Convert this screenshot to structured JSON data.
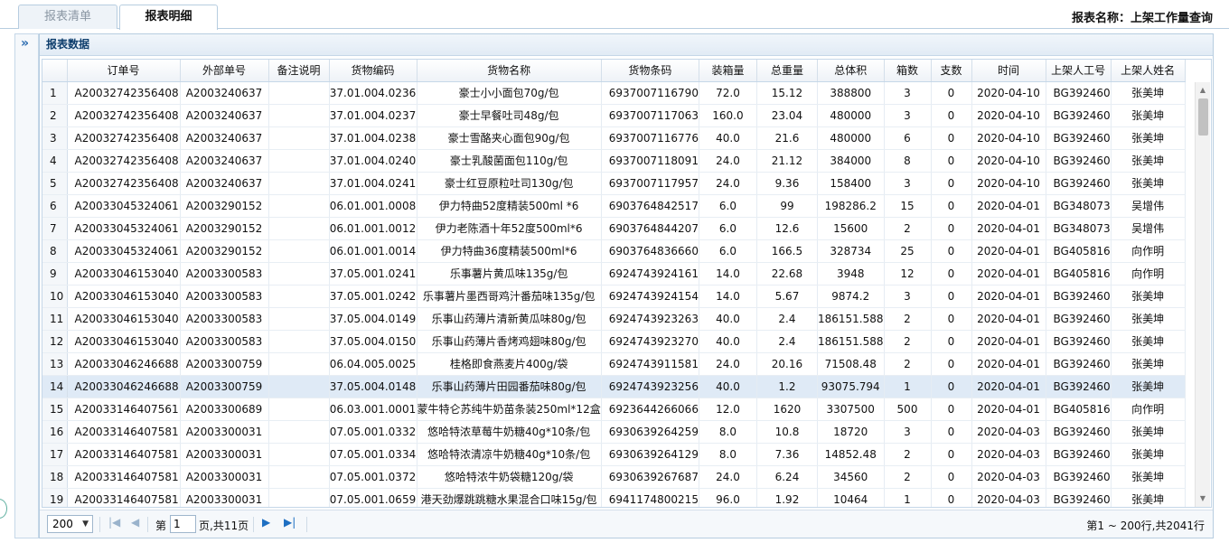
{
  "tabs": [
    {
      "label": "报表清单",
      "active": false
    },
    {
      "label": "报表明细",
      "active": true
    }
  ],
  "report_name": "报表名称：上架工作量查询",
  "panel": {
    "title": "报表数据",
    "collapse_icon": "double-chevron-right-icon"
  },
  "table": {
    "columns": [
      "",
      "订单号",
      "外部单号",
      "备注说明",
      "货物编码",
      "货物名称",
      "货物条码",
      "装箱量",
      "总重量",
      "总体积",
      "箱数",
      "支数",
      "时间",
      "上架人工号",
      "上架人姓名"
    ],
    "selected_row": 14,
    "rows": [
      [
        "1",
        "A20032742356408",
        "A2003240637",
        "",
        "37.01.004.0236",
        "豪士小小面包70g/包",
        "6937007116790",
        "72.0",
        "15.12",
        "388800",
        "3",
        "0",
        "2020-04-10",
        "BG392460",
        "张美坤"
      ],
      [
        "2",
        "A20032742356408",
        "A2003240637",
        "",
        "37.01.004.0237",
        "豪士早餐吐司48g/包",
        "6937007117063",
        "160.0",
        "23.04",
        "480000",
        "3",
        "0",
        "2020-04-10",
        "BG392460",
        "张美坤"
      ],
      [
        "3",
        "A20032742356408",
        "A2003240637",
        "",
        "37.01.004.0238",
        "豪士雪酪夹心面包90g/包",
        "6937007116776",
        "40.0",
        "21.6",
        "480000",
        "6",
        "0",
        "2020-04-10",
        "BG392460",
        "张美坤"
      ],
      [
        "4",
        "A20032742356408",
        "A2003240637",
        "",
        "37.01.004.0240",
        "豪士乳酸菌面包110g/包",
        "6937007118091",
        "24.0",
        "21.12",
        "384000",
        "8",
        "0",
        "2020-04-10",
        "BG392460",
        "张美坤"
      ],
      [
        "5",
        "A20032742356408",
        "A2003240637",
        "",
        "37.01.004.0241",
        "豪士红豆原粒吐司130g/包",
        "6937007117957",
        "24.0",
        "9.36",
        "158400",
        "3",
        "0",
        "2020-04-10",
        "BG392460",
        "张美坤"
      ],
      [
        "6",
        "A20033045324061",
        "A2003290152",
        "",
        "06.01.001.0008",
        "伊力特曲52度精装500ml *6",
        "6903764842517",
        "6.0",
        "99",
        "198286.2",
        "15",
        "0",
        "2020-04-01",
        "BG348073",
        "吴增伟"
      ],
      [
        "7",
        "A20033045324061",
        "A2003290152",
        "",
        "06.01.001.0012",
        "伊力老陈酒十年52度500ml*6",
        "6903764844207",
        "6.0",
        "12.6",
        "15600",
        "2",
        "0",
        "2020-04-01",
        "BG348073",
        "吴增伟"
      ],
      [
        "8",
        "A20033045324061",
        "A2003290152",
        "",
        "06.01.001.0014",
        "伊力特曲36度精装500ml*6",
        "6903764836660",
        "6.0",
        "166.5",
        "328734",
        "25",
        "0",
        "2020-04-01",
        "BG405816",
        "向作明"
      ],
      [
        "9",
        "A20033046153040",
        "A2003300583",
        "",
        "37.05.001.0241",
        "乐事薯片黄瓜味135g/包",
        "6924743924161",
        "14.0",
        "22.68",
        "3948",
        "12",
        "0",
        "2020-04-01",
        "BG405816",
        "向作明"
      ],
      [
        "10",
        "A20033046153040",
        "A2003300583",
        "",
        "37.05.001.0242",
        "乐事薯片墨西哥鸡汁番茄味135g/包",
        "6924743924154",
        "14.0",
        "5.67",
        "9874.2",
        "3",
        "0",
        "2020-04-01",
        "BG392460",
        "张美坤"
      ],
      [
        "11",
        "A20033046153040",
        "A2003300583",
        "",
        "37.05.004.0149",
        "乐事山药薄片清新黄瓜味80g/包",
        "6924743923263",
        "40.0",
        "2.4",
        "186151.588",
        "2",
        "0",
        "2020-04-01",
        "BG392460",
        "张美坤"
      ],
      [
        "12",
        "A20033046153040",
        "A2003300583",
        "",
        "37.05.004.0150",
        "乐事山药薄片香烤鸡翅味80g/包",
        "6924743923270",
        "40.0",
        "2.4",
        "186151.588",
        "2",
        "0",
        "2020-04-01",
        "BG392460",
        "张美坤"
      ],
      [
        "13",
        "A20033046246688",
        "A2003300759",
        "",
        "06.04.005.0025",
        "桂格即食燕麦片400g/袋",
        "6924743911581",
        "24.0",
        "20.16",
        "71508.48",
        "2",
        "0",
        "2020-04-01",
        "BG392460",
        "张美坤"
      ],
      [
        "14",
        "A20033046246688",
        "A2003300759",
        "",
        "37.05.004.0148",
        "乐事山药薄片田园番茄味80g/包",
        "6924743923256",
        "40.0",
        "1.2",
        "93075.794",
        "1",
        "0",
        "2020-04-01",
        "BG392460",
        "张美坤"
      ],
      [
        "15",
        "A20033146407561",
        "A2003300689",
        "",
        "06.03.001.0001",
        "蒙牛特仑苏纯牛奶苗条装250ml*12盒",
        "6923644266066",
        "12.0",
        "1620",
        "3307500",
        "500",
        "0",
        "2020-04-01",
        "BG405816",
        "向作明"
      ],
      [
        "16",
        "A20033146407581",
        "A2003300031",
        "",
        "07.05.001.0332",
        "悠哈特浓草莓牛奶糖40g*10条/包",
        "6930639264259",
        "8.0",
        "10.8",
        "18720",
        "3",
        "0",
        "2020-04-03",
        "BG392460",
        "张美坤"
      ],
      [
        "17",
        "A20033146407581",
        "A2003300031",
        "",
        "07.05.001.0334",
        "悠哈特浓清凉牛奶糖40g*10条/包",
        "6930639264129",
        "8.0",
        "7.36",
        "14852.48",
        "2",
        "0",
        "2020-04-03",
        "BG392460",
        "张美坤"
      ],
      [
        "18",
        "A20033146407581",
        "A2003300031",
        "",
        "07.05.001.0372",
        "悠哈特浓牛奶袋糖120g/袋",
        "6930639267687",
        "24.0",
        "6.24",
        "34560",
        "2",
        "0",
        "2020-04-03",
        "BG392460",
        "张美坤"
      ],
      [
        "19",
        "A20033146407581",
        "A2003300031",
        "",
        "07.05.001.0659",
        "港天劲爆跳跳糖水果混合口味15g/包",
        "6941174800215",
        "96.0",
        "1.92",
        "10464",
        "1",
        "0",
        "2020-04-03",
        "BG392460",
        "张美坤"
      ]
    ]
  },
  "pager": {
    "page_size": "200",
    "page_prefix": "第",
    "page_value": "1",
    "page_suffix": "页,共11页",
    "info": "第1 ~ 200行,共2041行",
    "icons": [
      "first-page-icon",
      "prev-page-icon",
      "next-page-icon",
      "last-page-icon"
    ]
  },
  "colors": {
    "accent": "#1e6fc2",
    "header_text": "#0d3d6c",
    "selected_row": "#dfeaf6",
    "border": "#b7cde0"
  }
}
